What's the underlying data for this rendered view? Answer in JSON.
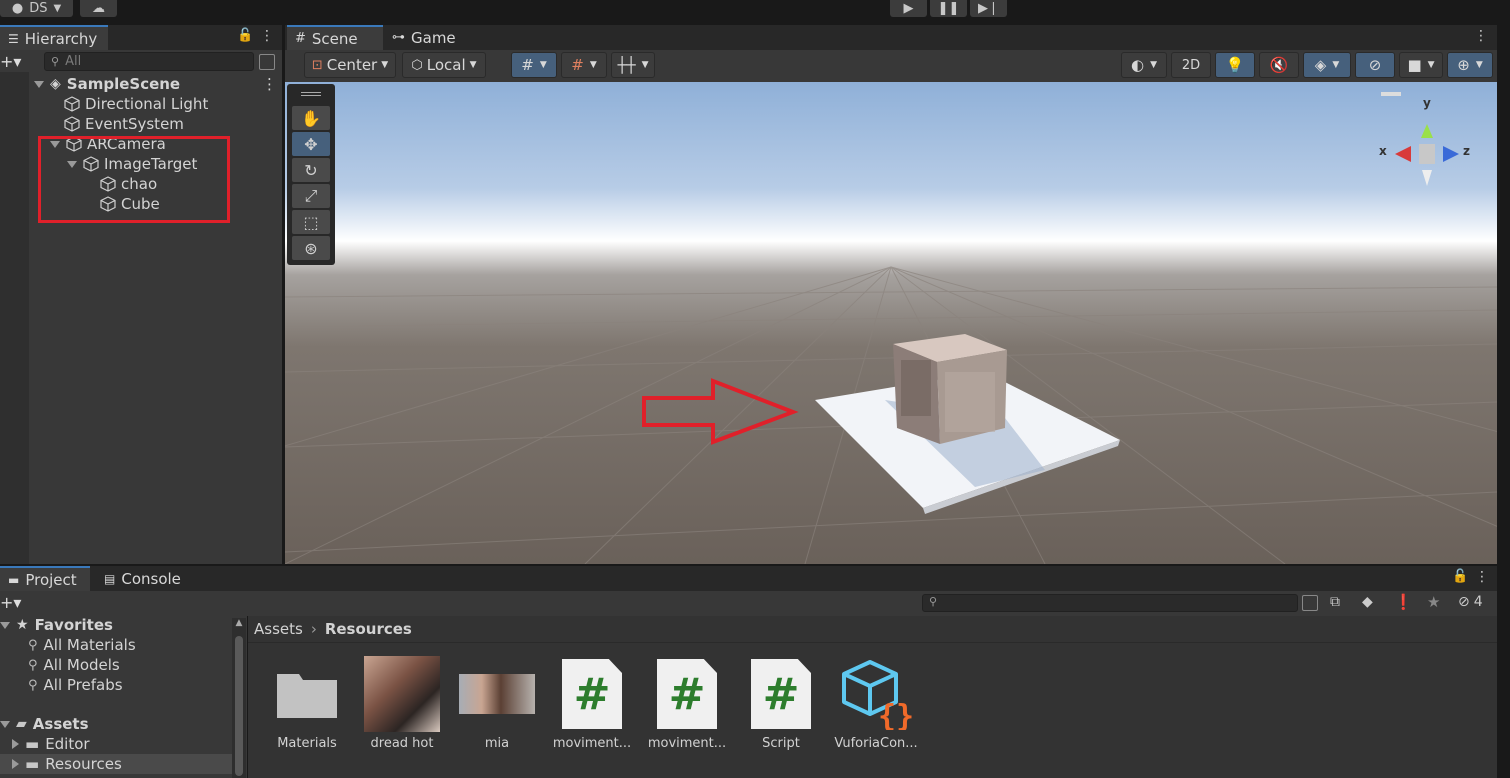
{
  "topbar": {
    "account": "DS"
  },
  "hierarchy": {
    "tab": "Hierarchy",
    "search_placeholder": "All",
    "scene": "SampleScene",
    "items": [
      "Directional Light",
      "EventSystem",
      "ARCamera",
      "ImageTarget",
      "chao",
      "Cube"
    ]
  },
  "scene_view": {
    "tabs": [
      "Scene",
      "Game"
    ],
    "pivot": "Center",
    "space": "Local",
    "mode_2d": "2D",
    "gizmo": {
      "y": "y",
      "x": "x",
      "z": "z"
    }
  },
  "project": {
    "tabs": [
      "Project",
      "Console"
    ],
    "hidden_count": "4",
    "favorites": {
      "label": "Favorites",
      "items": [
        "All Materials",
        "All Models",
        "All Prefabs"
      ]
    },
    "assets": {
      "label": "Assets",
      "items": [
        "Editor",
        "Resources"
      ]
    },
    "breadcrumb": [
      "Assets",
      "Resources"
    ],
    "files": [
      "Materials",
      "dread hot",
      "mia",
      "moviment...",
      "moviment...",
      "Script",
      "VuforiaCon..."
    ]
  },
  "colors": {
    "accent": "#3a79bb",
    "annotation": "#e0202a",
    "script_hash": "#2d7d2d",
    "vuforia_cube": "#5ec8f0",
    "vuforia_braces": "#f06a2a"
  }
}
